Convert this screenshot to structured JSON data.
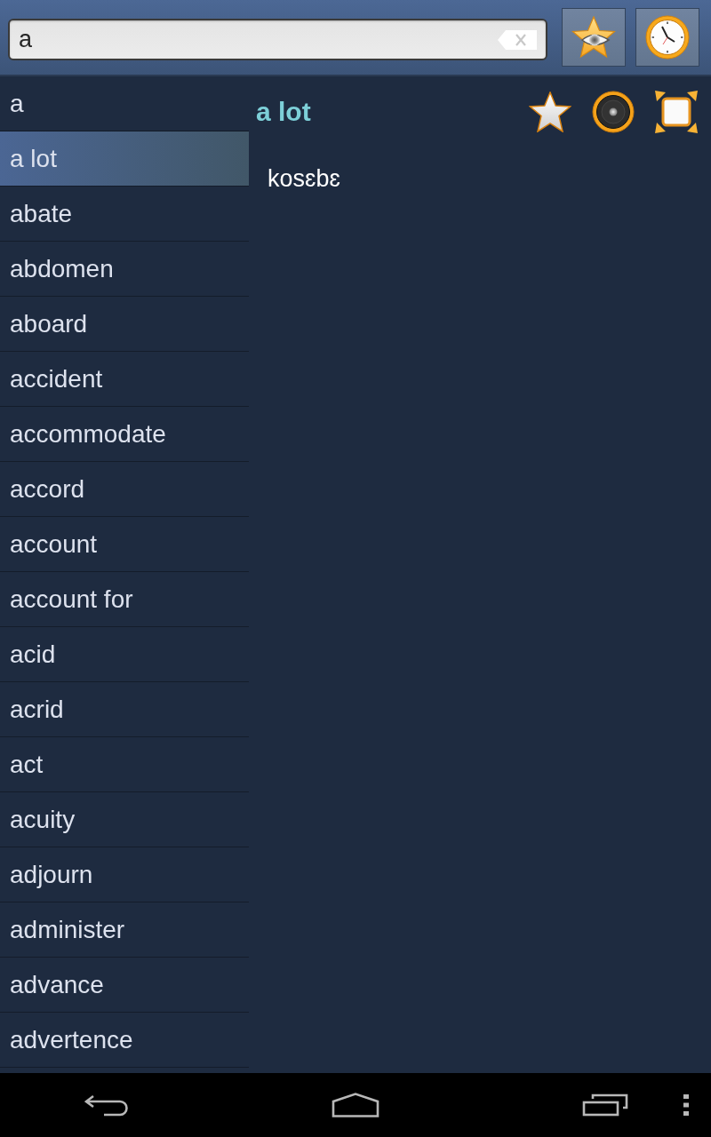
{
  "search": {
    "value": "a"
  },
  "word_list": [
    {
      "label": "a",
      "selected": false
    },
    {
      "label": "a lot",
      "selected": true
    },
    {
      "label": "abate",
      "selected": false
    },
    {
      "label": "abdomen",
      "selected": false
    },
    {
      "label": "aboard",
      "selected": false
    },
    {
      "label": "accident",
      "selected": false
    },
    {
      "label": "accommodate",
      "selected": false
    },
    {
      "label": "accord",
      "selected": false
    },
    {
      "label": "account",
      "selected": false
    },
    {
      "label": "account for",
      "selected": false
    },
    {
      "label": "acid",
      "selected": false
    },
    {
      "label": "acrid",
      "selected": false
    },
    {
      "label": "act",
      "selected": false
    },
    {
      "label": "acuity",
      "selected": false
    },
    {
      "label": "adjourn",
      "selected": false
    },
    {
      "label": "administer",
      "selected": false
    },
    {
      "label": "advance",
      "selected": false
    },
    {
      "label": "advertence",
      "selected": false
    }
  ],
  "entry": {
    "headword": "a lot",
    "translation": "kosɛbɛ"
  }
}
